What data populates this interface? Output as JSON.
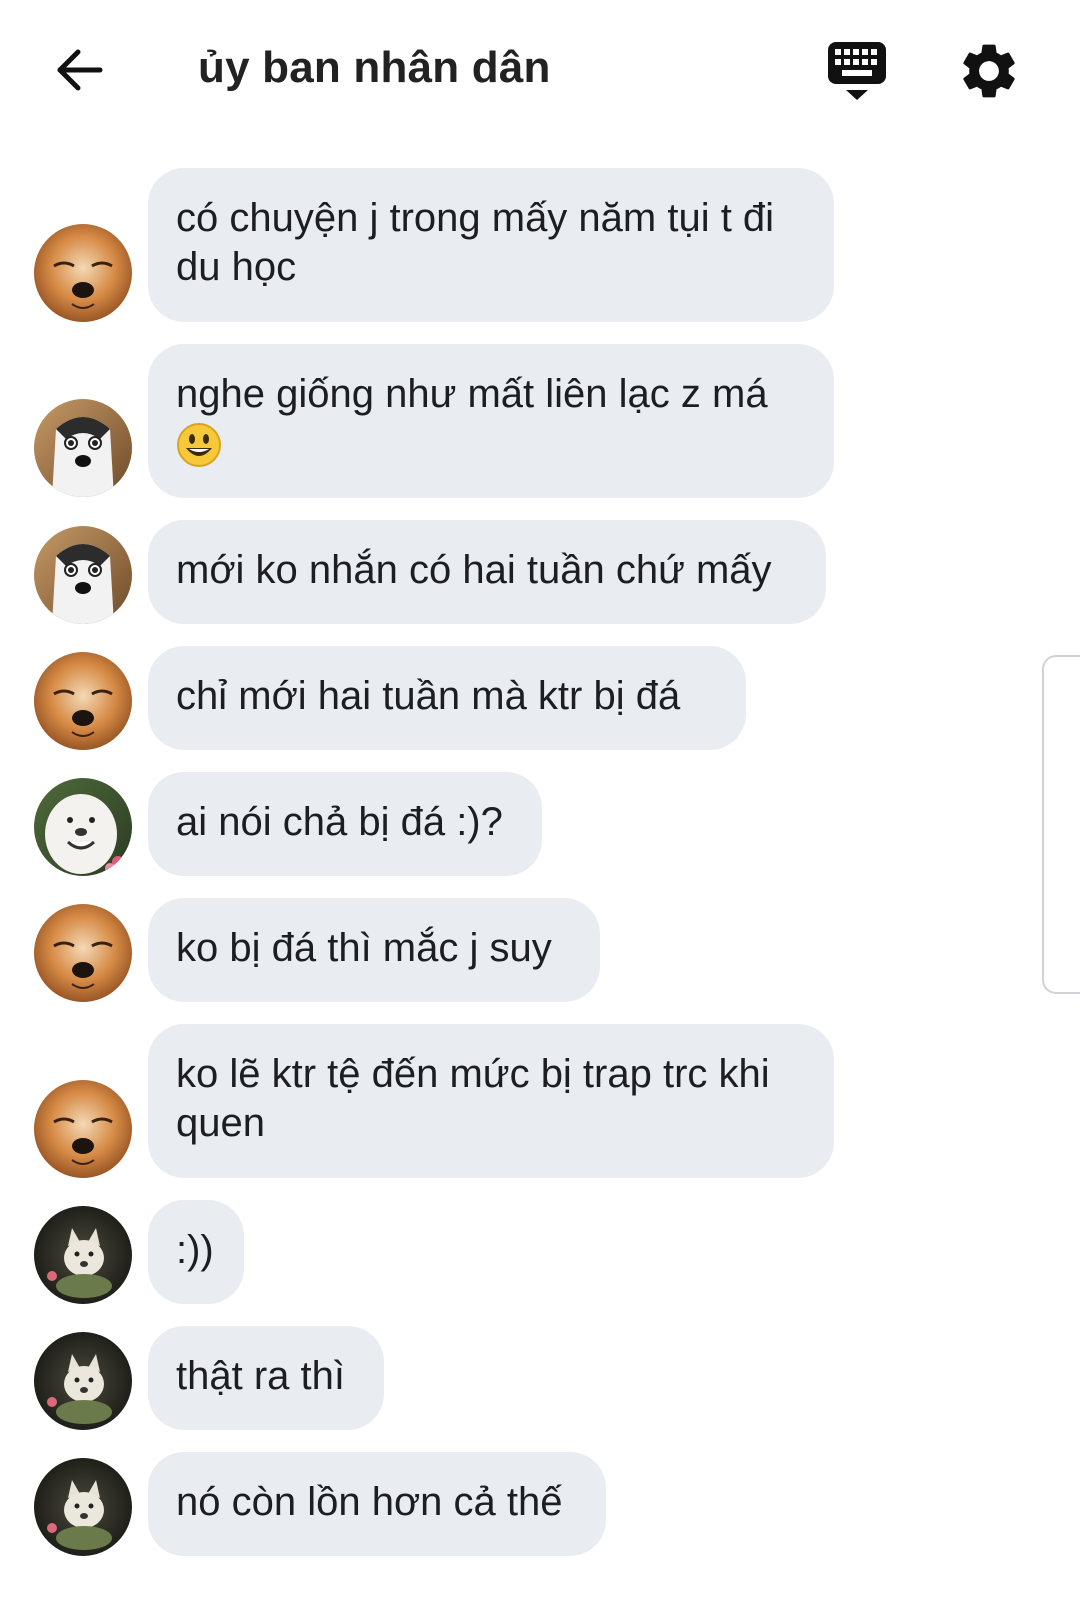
{
  "header": {
    "title": "ủy ban nhân dân",
    "back_icon": "arrow-left-icon",
    "keyboard_icon": "keyboard-icon",
    "settings_icon": "gear-icon"
  },
  "colors": {
    "bubble": "#e9ecf1",
    "text": "#1c1e21",
    "icon": "#111111"
  },
  "messages": [
    {
      "avatar": "fox",
      "text": "có chuyện j trong mấy năm tụi t đi du học"
    },
    {
      "avatar": "husky",
      "text": "nghe giống như mất liên lạc z má",
      "emoji": "grinning-face-emoji"
    },
    {
      "avatar": "husky",
      "text": "mới ko nhắn có hai tuần chứ mấy"
    },
    {
      "avatar": "fox",
      "text": "chỉ mới hai tuần mà ktr bị đá"
    },
    {
      "avatar": "white-dog",
      "text": "ai nói chả bị đá :)?"
    },
    {
      "avatar": "fox",
      "text": "ko bị đá thì mắc j suy"
    },
    {
      "avatar": "fox",
      "text": "ko lẽ ktr tệ đến mức bị trap trc khi quen"
    },
    {
      "avatar": "dark-dog",
      "text": ":))"
    },
    {
      "avatar": "dark-dog",
      "text": "thật ra thì"
    },
    {
      "avatar": "dark-dog",
      "text": "nó còn lồn hơn cả thế"
    }
  ]
}
